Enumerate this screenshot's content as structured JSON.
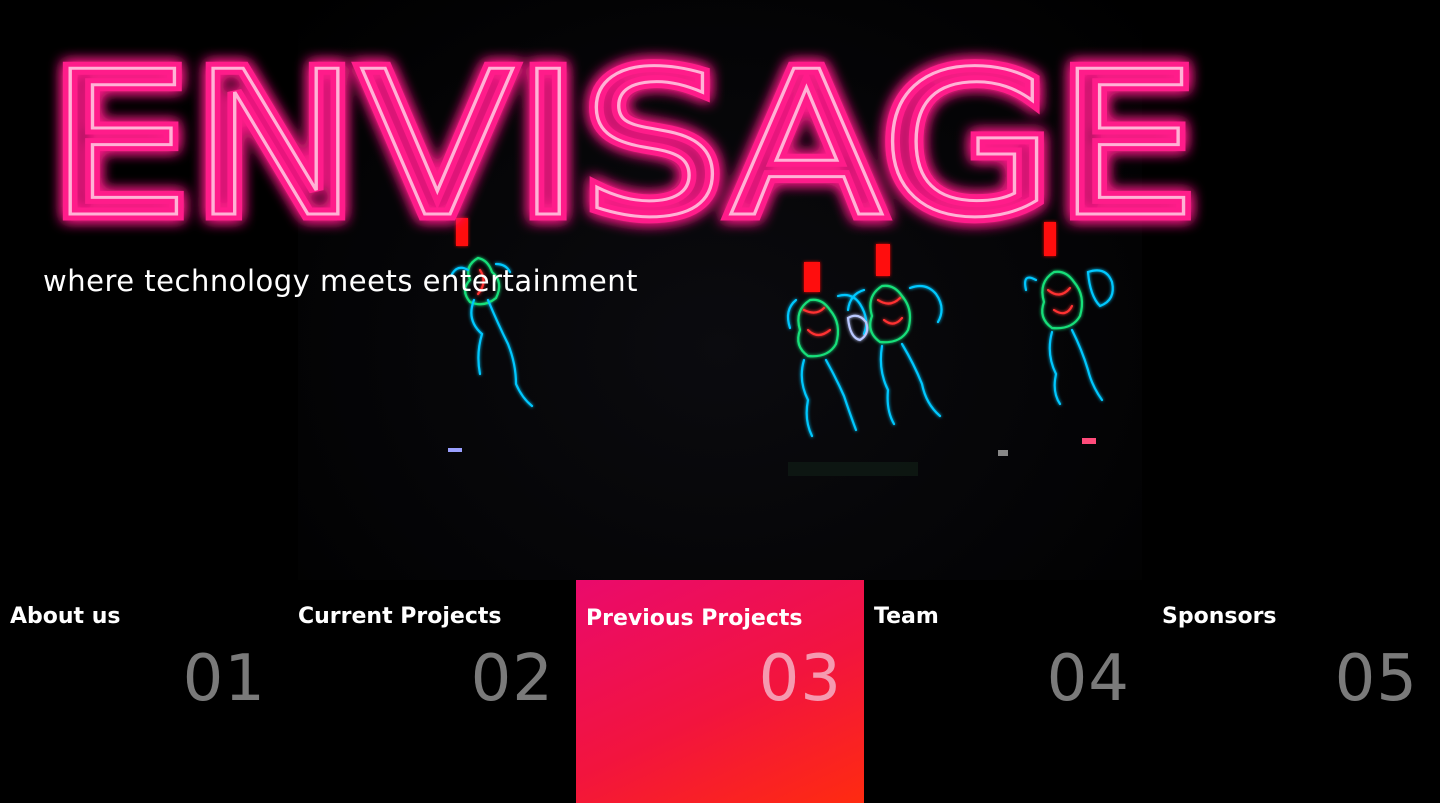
{
  "brand": {
    "title": "ENVISAGE",
    "tagline": "where technology meets entertainment",
    "neon_color": "#ff1f8a",
    "neon_core_color": "#ffb3d6"
  },
  "nav": {
    "items": [
      {
        "label": "About us",
        "number": "01",
        "active": false
      },
      {
        "label": "Current Projects",
        "number": "02",
        "active": false
      },
      {
        "label": "Previous Projects",
        "number": "03",
        "active": true
      },
      {
        "label": "Team",
        "number": "04",
        "active": false
      },
      {
        "label": "Sponsors",
        "number": "05",
        "active": false
      }
    ],
    "active_gradient": [
      "#ea0a6c",
      "#ff2b10"
    ],
    "number_color": "#7a7a7a"
  },
  "hero_image": {
    "subject": "dancers-in-light-up-suits",
    "colors": [
      "#00c8ff",
      "#19e07a",
      "#ff1010"
    ]
  }
}
